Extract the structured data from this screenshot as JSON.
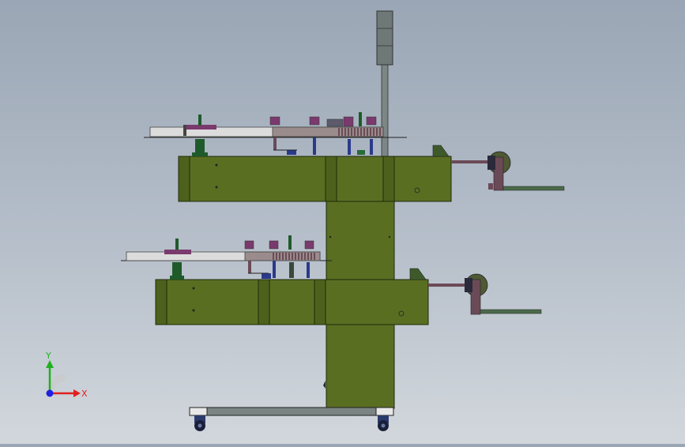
{
  "viewport": {
    "triad": {
      "x_label": "X",
      "y_label": "Y",
      "x_color": "#e02020",
      "y_color": "#20b020",
      "z_color": "#2020e0"
    },
    "colors": {
      "body_green": "#5a6e22",
      "body_green_dark": "#3e4d16",
      "body_outline": "#1f2a0a",
      "steel": "#6d7b7a",
      "pole": "#7c8684",
      "bracket": "#6b4a57",
      "purple": "#7a3a6e",
      "blue": "#2a3a8a",
      "belt": "#dcdcdc",
      "dark_green_accent": "#1f5a2a"
    }
  }
}
